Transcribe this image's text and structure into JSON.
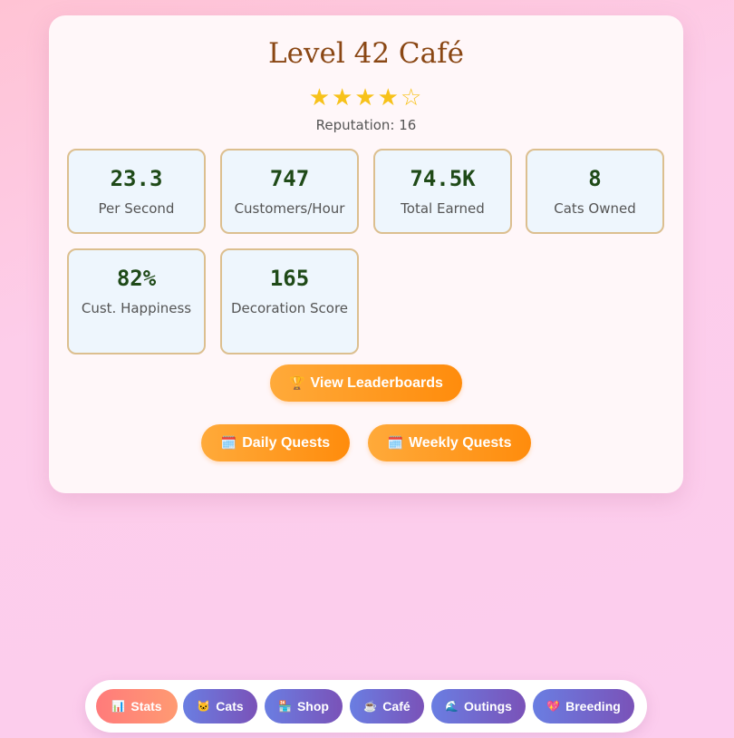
{
  "cafe": {
    "title": "Level 42 Café",
    "stars_filled": "★★★★",
    "stars_empty": "☆",
    "rating": 4,
    "rating_max": 5,
    "reputation": "Reputation: 16"
  },
  "stats": [
    {
      "value": "23.3",
      "label": "Per Second"
    },
    {
      "value": "747",
      "label": "Customers/Hour"
    },
    {
      "value": "74.5K",
      "label": "Total Earned"
    },
    {
      "value": "8",
      "label": "Cats Owned"
    },
    {
      "value": "82%",
      "label": "Cust. Happiness"
    },
    {
      "value": "165",
      "label": "Decoration Score"
    }
  ],
  "buttons": {
    "leaderboards": {
      "icon": "🏆",
      "label": "View Leaderboards"
    },
    "daily": {
      "icon": "🗓️",
      "label": "Daily Quests"
    },
    "weekly": {
      "icon": "🗓️",
      "label": "Weekly Quests"
    }
  },
  "nav": [
    {
      "icon": "📊",
      "label": "Stats",
      "active": true
    },
    {
      "icon": "🐱",
      "label": "Cats"
    },
    {
      "icon": "🏪",
      "label": "Shop"
    },
    {
      "icon": "☕",
      "label": "Café"
    },
    {
      "icon": "🌊",
      "label": "Outings"
    },
    {
      "icon": "💖",
      "label": "Breeding"
    }
  ],
  "colors": {
    "accent": "#ff8c0c",
    "nav": "#6a7ee2",
    "nav_active": "#ff7b7b",
    "title": "#8a4714"
  }
}
